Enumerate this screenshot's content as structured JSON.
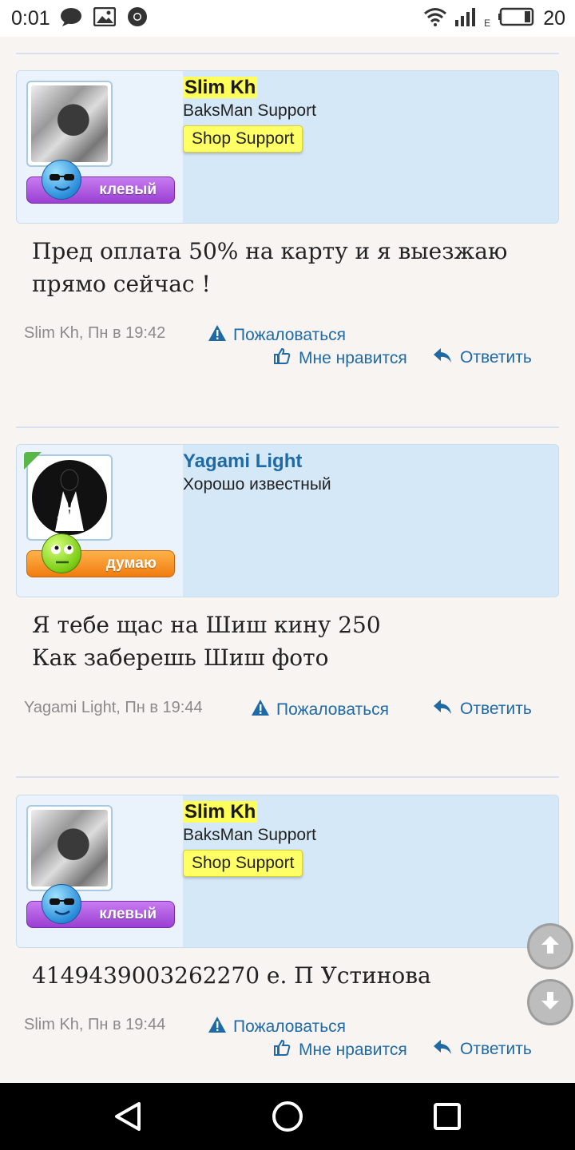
{
  "status_bar": {
    "time": "0:01",
    "network_label": "E",
    "battery": "20"
  },
  "posts": [
    {
      "username": "Slim Kh",
      "user_title": "BaksMan Support",
      "user_banner": "Shop Support",
      "mood": "клевый",
      "message": "Пред оплата 50% на карту и я выезжаю прямо сейчас !",
      "meta": "Slim Kh, Пн в 19:42",
      "report": "Пожаловаться",
      "like": "Мне нравится",
      "reply": "Ответить"
    },
    {
      "username": "Yagami Light",
      "user_title": "Хорошо известный",
      "mood": "думаю",
      "message_lines": [
        "Я тебе щас на Шиш кину 250",
        "Как заберешь Шиш фото"
      ],
      "meta": "Yagami Light, Пн в 19:44",
      "report": "Пожаловаться",
      "reply": "Ответить"
    },
    {
      "username": "Slim Kh",
      "user_title": "BaksMan Support",
      "user_banner": "Shop Support",
      "mood": "клевый",
      "message": "4149439003262270 е. П Устинова",
      "meta": "Slim Kh, Пн в 19:44",
      "report": "Пожаловаться",
      "like": "Мне нравится",
      "reply": "Ответить"
    }
  ],
  "colors": {
    "link": "#1f6aa5",
    "userbox": "#d5e8f7",
    "highlight": "#ffff5a"
  }
}
